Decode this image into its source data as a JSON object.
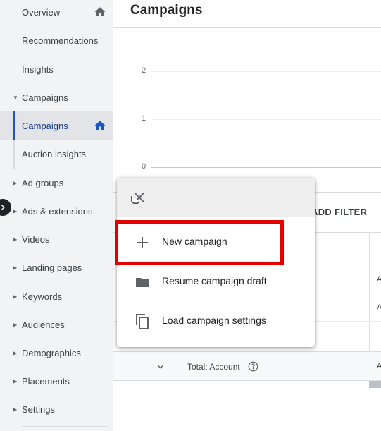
{
  "sidebar": {
    "items": [
      {
        "label": "Overview",
        "home": true
      },
      {
        "label": "Recommendations"
      },
      {
        "label": "Insights"
      },
      {
        "label": "Campaigns",
        "caret": "▼"
      },
      {
        "label": "Campaigns",
        "home": true,
        "active": true
      },
      {
        "label": "Auction insights"
      },
      {
        "label": "Ad groups",
        "caret": "▶"
      },
      {
        "label": "Ads & extensions",
        "caret": "▶"
      },
      {
        "label": "Videos",
        "caret": "▶"
      },
      {
        "label": "Landing pages",
        "caret": "▶"
      },
      {
        "label": "Keywords",
        "caret": "▶"
      },
      {
        "label": "Audiences",
        "caret": "▶"
      },
      {
        "label": "Demographics",
        "caret": "▶"
      },
      {
        "label": "Placements",
        "caret": "▶"
      },
      {
        "label": "Settings",
        "caret": "▶"
      }
    ]
  },
  "header": {
    "title": "Campaigns"
  },
  "chart": {
    "ticks": [
      "2",
      "1",
      "0"
    ]
  },
  "filter_bar": {
    "add_filter": "ADD FILTER"
  },
  "table": {
    "row_cells": [
      "A",
      "A"
    ],
    "total_label": "Total: Account",
    "total_cell": "A"
  },
  "menu": {
    "items": [
      {
        "label": "New campaign",
        "icon": "plus-icon"
      },
      {
        "label": "Resume campaign draft",
        "icon": "folder-icon"
      },
      {
        "label": "Load campaign settings",
        "icon": "copy-icon"
      }
    ]
  },
  "colors": {
    "accent": "#1a56c4",
    "highlight": "#e00000",
    "sidebar_bg": "#f1f3f4"
  }
}
